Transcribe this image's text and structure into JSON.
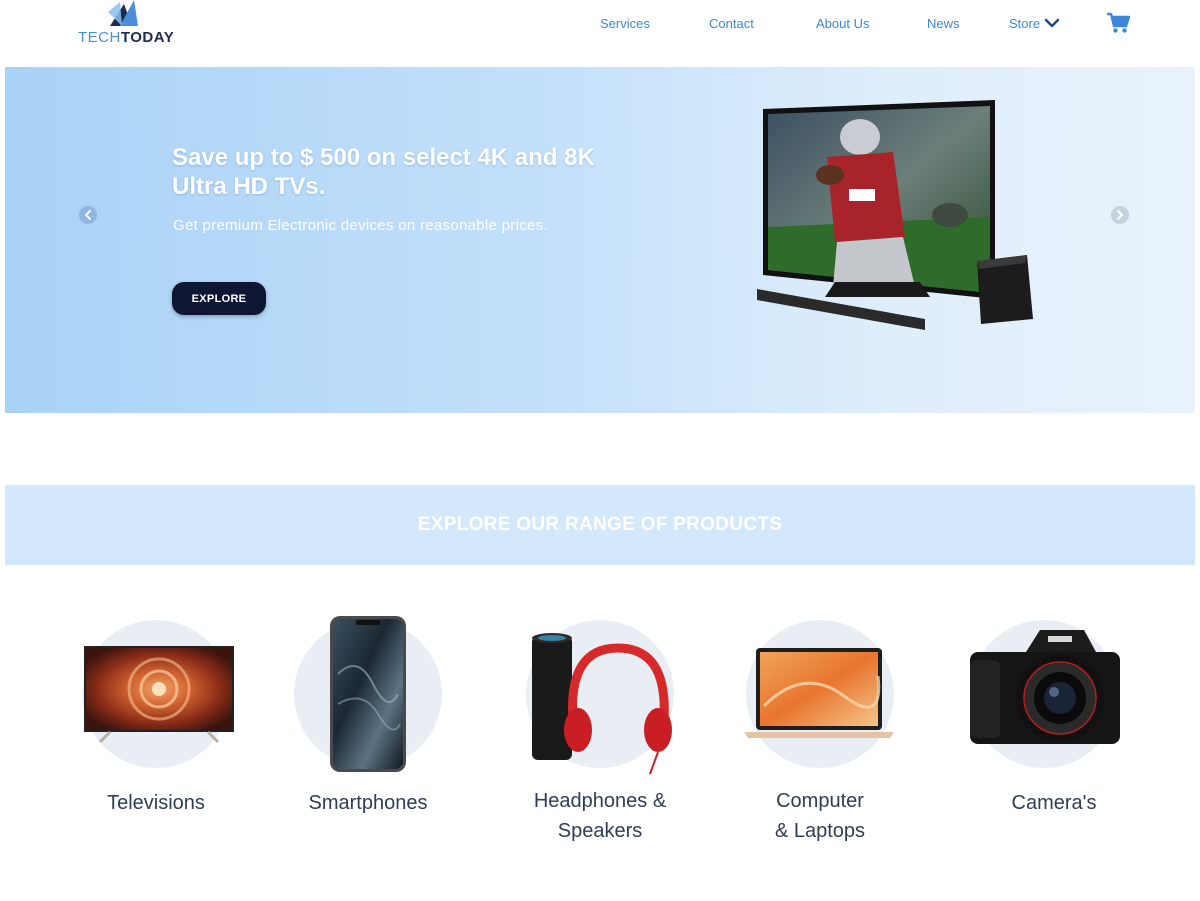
{
  "logo": {
    "part1": "TECH",
    "part2": "TODAY"
  },
  "nav": {
    "items": [
      {
        "label": "Services"
      },
      {
        "label": "Contact"
      },
      {
        "label": "About Us"
      },
      {
        "label": "News"
      },
      {
        "label": "Store"
      }
    ]
  },
  "icons": {
    "cart": "shopping-cart-icon",
    "store_dropdown": "chevron-down-icon",
    "prev": "chevron-left-icon",
    "next": "chevron-right-icon"
  },
  "hero": {
    "title": "Save up to $ 500 on select 4K and 8K Ultra HD TVs.",
    "subtitle": "Get premium Electronic devices on reasonable prices.",
    "cta": "EXPLORE"
  },
  "range": {
    "title": "EXPLORE OUR RANGE OF PRODUCTS"
  },
  "categories": [
    {
      "line1": "Televisions",
      "line2": ""
    },
    {
      "line1": "Smartphones",
      "line2": ""
    },
    {
      "line1": "Headphones &",
      "line2": "Speakers"
    },
    {
      "line1": "Computer",
      "line2": "& Laptops"
    },
    {
      "line1": "Camera's",
      "line2": ""
    }
  ],
  "colors": {
    "nav_link": "#3d87d9",
    "hero_bg_start": "#a9d2f7",
    "hero_bg_end": "#e9f2fb",
    "cta_bg": "#0f1633",
    "banner_bg": "#d4e8fb",
    "category_text": "#2f3d56"
  }
}
